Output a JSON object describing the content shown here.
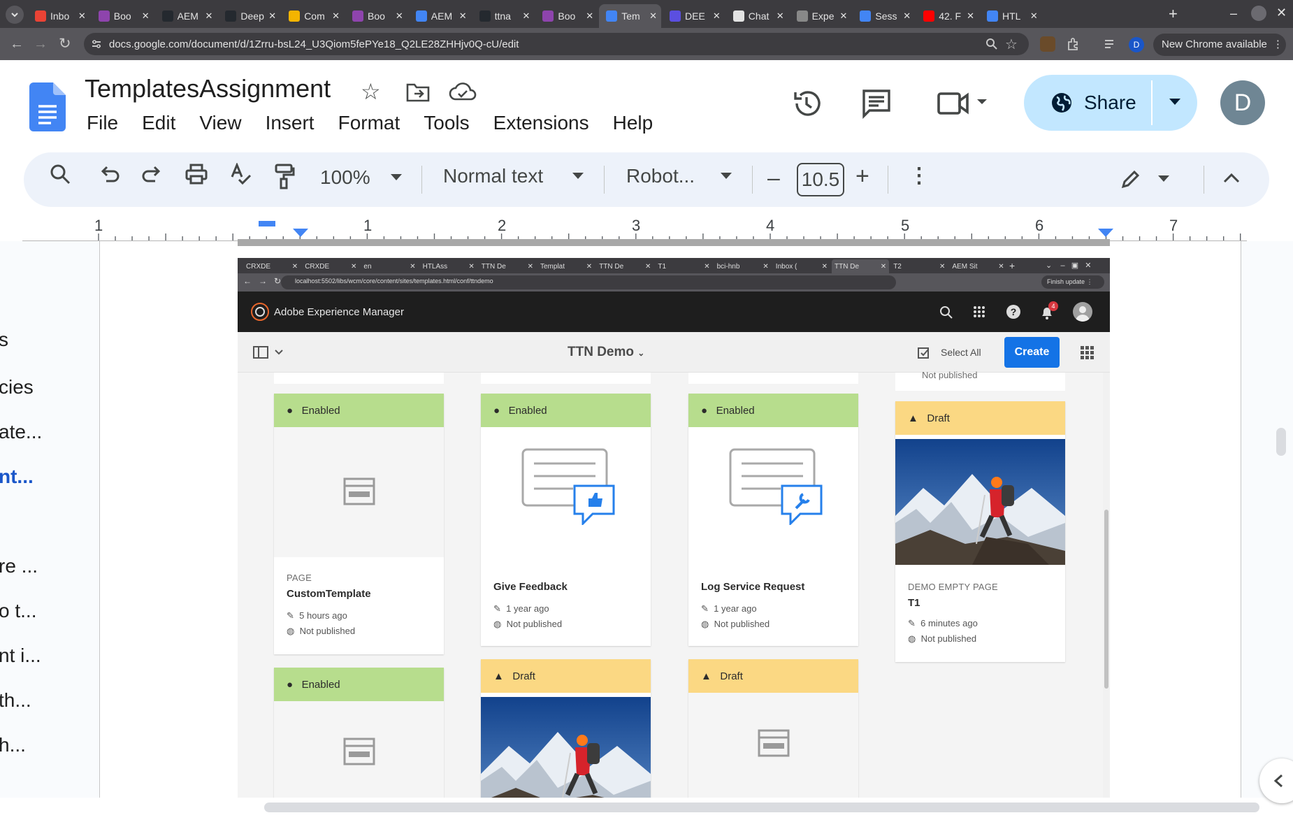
{
  "browser": {
    "tabs": [
      {
        "label": "Inbo",
        "color": "#ea4335"
      },
      {
        "label": "Boo",
        "color": "#8e44ad"
      },
      {
        "label": "AEM",
        "color": "#24292f"
      },
      {
        "label": "Deep",
        "color": "#24292f"
      },
      {
        "label": "Com",
        "color": "#f4b400"
      },
      {
        "label": "Boo",
        "color": "#8e44ad"
      },
      {
        "label": "AEM",
        "color": "#4285f4"
      },
      {
        "label": "ttna",
        "color": "#24292f"
      },
      {
        "label": "Boo",
        "color": "#8e44ad"
      },
      {
        "label": "Tem",
        "color": "#4285f4"
      },
      {
        "label": "DEE",
        "color": "#5b4fe0"
      },
      {
        "label": "Chat",
        "color": "#e3e3e3"
      },
      {
        "label": "Expe",
        "color": "#888888"
      },
      {
        "label": "Sess",
        "color": "#4285f4"
      },
      {
        "label": "42. F",
        "color": "#ff0000"
      },
      {
        "label": "HTL",
        "color": "#4285f4"
      }
    ],
    "url": "docs.google.com/document/d/1Zrru-bsL24_U3Qiom5fePYe18_Q2LE28ZHHjv0Q-cU/edit",
    "chrome_update": "New Chrome available",
    "profile_initial": "D"
  },
  "docs": {
    "title": "TemplatesAssignment",
    "menu": [
      "File",
      "Edit",
      "View",
      "Insert",
      "Format",
      "Tools",
      "Extensions",
      "Help"
    ],
    "share_label": "Share",
    "avatar_initial": "D",
    "zoom": "100%",
    "style": "Normal text",
    "font": "Robot...",
    "font_size": "10.5",
    "ruler_numbers": [
      "1",
      "1",
      "2",
      "3",
      "4",
      "5",
      "6",
      "7"
    ]
  },
  "outline": [
    "s",
    "cies",
    "ate...",
    "nt...",
    "re ...",
    "o t...",
    "nt i...",
    "th...",
    "h..."
  ],
  "embedded": {
    "tabs": [
      "CRXDE",
      "CRXDE",
      "en",
      "HTLAss",
      "TTN De",
      "Templat",
      "TTN De",
      "T1",
      "bci-hnb",
      "Inbox (",
      "TTN De",
      "T2",
      "AEM Sit"
    ],
    "url": "localhost:5502/libs/wcm/core/content/sites/templates.html/conf/ttndemo",
    "finish_update": "Finish update",
    "product": "Adobe Experience Manager",
    "notification_count": "4",
    "breadcrumb": "TTN Demo",
    "select_all": "Select All",
    "create": "Create",
    "cards": [
      {
        "status": "Enabled",
        "type": "PAGE",
        "title": "CustomTemplate",
        "modified": "5 hours ago",
        "published": "Not published",
        "thumb": "page-icon"
      },
      {
        "status": "Enabled",
        "type": "",
        "title": "Give Feedback",
        "modified": "1 year ago",
        "published": "Not published",
        "thumb": "feedback-icon"
      },
      {
        "status": "Enabled",
        "type": "",
        "title": "Log Service Request",
        "modified": "1 year ago",
        "published": "Not published",
        "thumb": "service-icon"
      },
      {
        "status": "Draft",
        "type": "DEMO EMPTY PAGE",
        "title": "T1",
        "modified": "6 minutes ago",
        "published": "Not published",
        "thumb": "hiker-photo"
      },
      {
        "status": "Enabled",
        "thumb": "page-icon"
      },
      {
        "status": "Draft",
        "thumb": "hiker-photo"
      },
      {
        "status": "Draft",
        "thumb": "page-icon"
      }
    ],
    "partial_top_card_text": "Not published"
  },
  "colors": {
    "enabled": "#b7dd8d",
    "draft": "#fbd883",
    "aem_blue": "#1473e6",
    "share_bg": "#c2e7ff"
  }
}
